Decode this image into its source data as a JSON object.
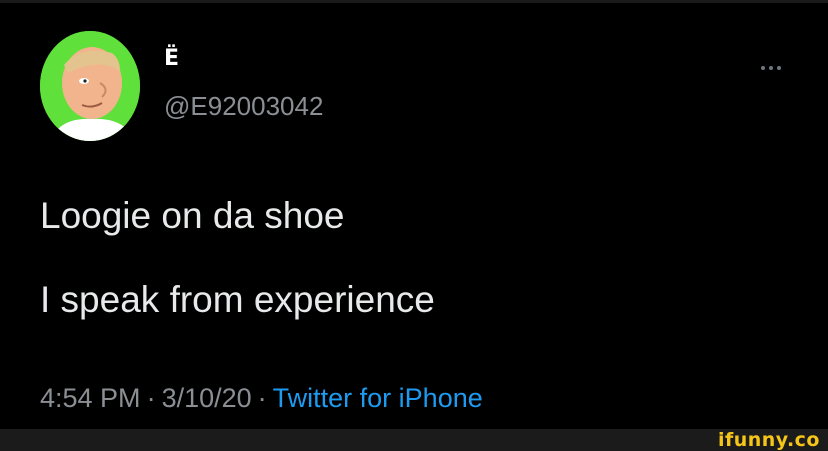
{
  "user": {
    "display_name": "Ë",
    "handle": "@E92003042",
    "avatar_icon": "cartoon-face-avatar",
    "avatar_bg": "#5fe03a"
  },
  "tweet": {
    "lines": [
      "Loogie on da shoe",
      "I speak from experience"
    ]
  },
  "meta": {
    "time": "4:54 PM",
    "separator": "·",
    "date": "3/10/20",
    "source": "Twitter for iPhone"
  },
  "more_icon": "more-horizontal-icon",
  "watermark": {
    "text": "ifunny.co"
  },
  "colors": {
    "background": "#000000",
    "text": "#e7e9ea",
    "secondary": "#8b8f94",
    "link": "#1d9bf0",
    "watermark": "#f5c518"
  }
}
